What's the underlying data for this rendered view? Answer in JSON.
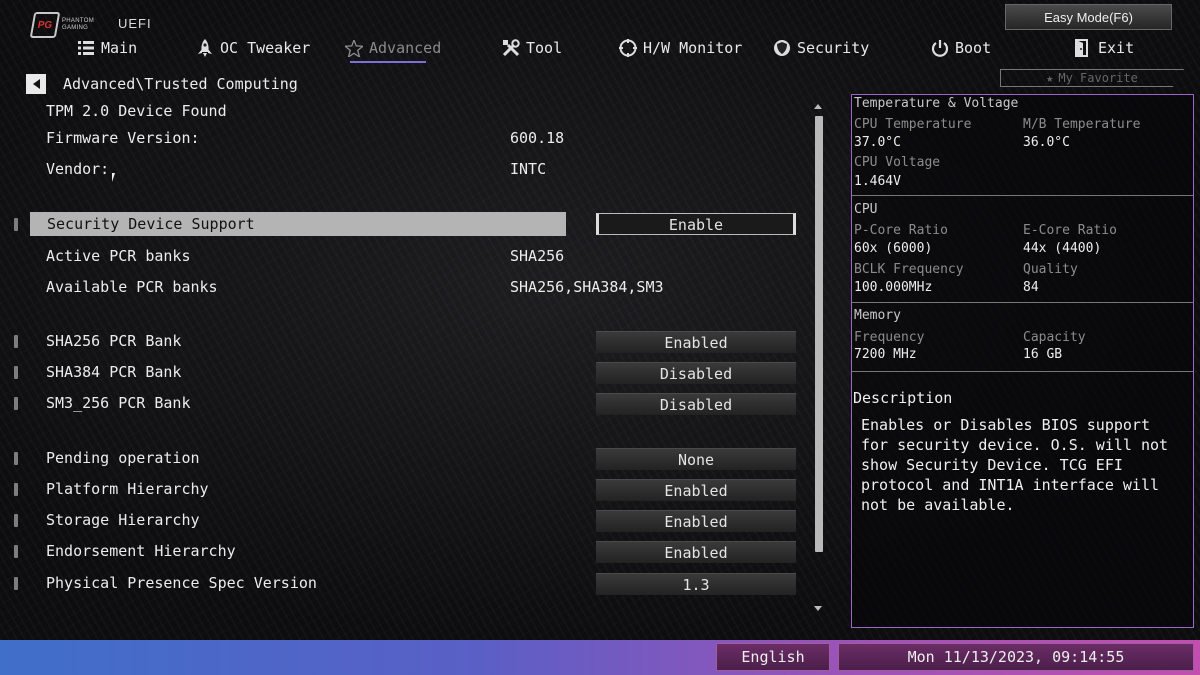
{
  "brand": {
    "logo_text": "PHANTOM GAMING",
    "uefi_label": "UEFI"
  },
  "easy_mode": "Easy Mode(F6)",
  "tabs": [
    {
      "label": "Main",
      "icon": "list-icon"
    },
    {
      "label": "OC Tweaker",
      "icon": "rocket-icon"
    },
    {
      "label": "Advanced",
      "icon": "star-icon",
      "active": true
    },
    {
      "label": "Tool",
      "icon": "tools-icon"
    },
    {
      "label": "H/W Monitor",
      "icon": "monitor-icon"
    },
    {
      "label": "Security",
      "icon": "shield-icon"
    },
    {
      "label": "Boot",
      "icon": "power-icon"
    },
    {
      "label": "Exit",
      "icon": "exit-icon"
    }
  ],
  "favorite": "My Favorite",
  "breadcrumb": "Advanced\\Trusted Computing",
  "info": {
    "device_found": "TPM 2.0 Device Found",
    "firmware_label": "Firmware Version:",
    "firmware_value": "600.18",
    "vendor_label": "Vendor:",
    "vendor_value": "INTC",
    "active_pcr_label": "Active PCR banks",
    "active_pcr_value": "SHA256",
    "available_pcr_label": "Available PCR banks",
    "available_pcr_value": "SHA256,SHA384,SM3"
  },
  "settings": {
    "security_device_support": {
      "label": "Security Device Support",
      "value": "Enable"
    },
    "sha256": {
      "label": "SHA256 PCR Bank",
      "value": "Enabled"
    },
    "sha384": {
      "label": "SHA384 PCR Bank",
      "value": "Disabled"
    },
    "sm3": {
      "label": "SM3_256 PCR Bank",
      "value": "Disabled"
    },
    "pending": {
      "label": "Pending operation",
      "value": "None"
    },
    "platform": {
      "label": "Platform Hierarchy",
      "value": "Enabled"
    },
    "storage": {
      "label": "Storage Hierarchy",
      "value": "Enabled"
    },
    "endorsement": {
      "label": "Endorsement Hierarchy",
      "value": "Enabled"
    },
    "pps_version": {
      "label": "Physical Presence Spec Version",
      "value": "1.3"
    }
  },
  "panel": {
    "temp_title": "Temperature & Voltage",
    "cpu_temp_label": "CPU Temperature",
    "cpu_temp_value": "37.0°C",
    "mb_temp_label": "M/B Temperature",
    "mb_temp_value": "36.0°C",
    "cpu_voltage_label": "CPU Voltage",
    "cpu_voltage_value": "1.464V",
    "cpu_title": "CPU",
    "pcore_label": "P-Core Ratio",
    "pcore_value": "60x (6000)",
    "ecore_label": "E-Core Ratio",
    "ecore_value": "44x (4400)",
    "bclk_label": "BCLK Frequency",
    "bclk_value": "100.000MHz",
    "quality_label": "Quality",
    "quality_value": "84",
    "memory_title": "Memory",
    "freq_label": "Frequency",
    "freq_value": "7200 MHz",
    "capacity_label": "Capacity",
    "capacity_value": "16 GB",
    "description_title": "Description",
    "description_text": "Enables or Disables BIOS support for security device. O.S. will not show Security Device. TCG EFI protocol and INT1A interface will not be available."
  },
  "footer": {
    "language": "English",
    "datetime": "Mon 11/13/2023, 09:14:55"
  },
  "colors": {
    "accent": "#7c6fd8",
    "panel_border": "#9a66c9",
    "highlight": "#b4b4b4"
  }
}
